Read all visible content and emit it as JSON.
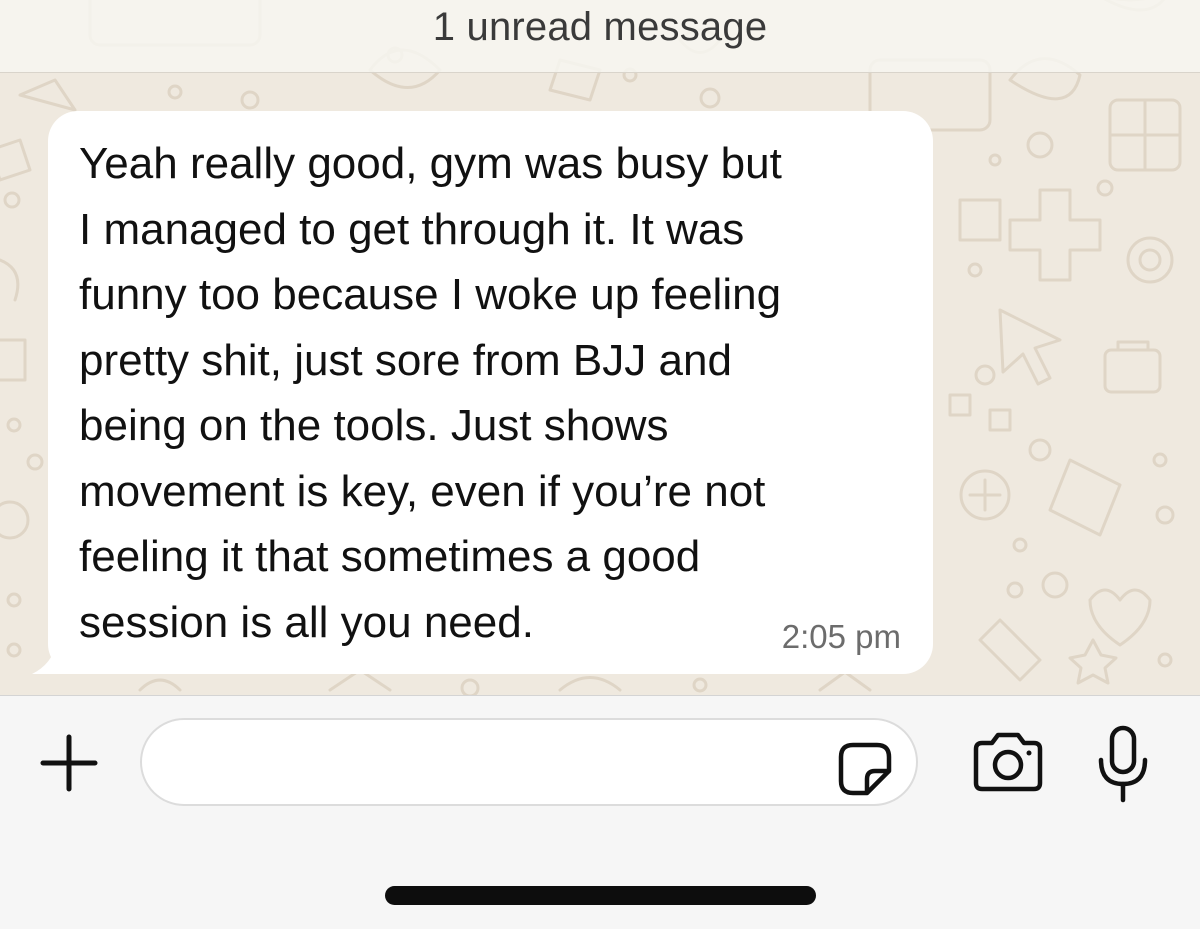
{
  "chat": {
    "unread_banner": "1 unread message",
    "message": {
      "text": "Yeah really good, gym was busy but\nI managed to get through it. It was\nfunny too because I woke up feeling\npretty shit, just sore from BJJ and\nbeing on the tools. Just shows\nmovement is key, even if you’re not\nfeeling it that sometimes a good\nsession is all you need.",
      "time": "2:05 pm",
      "direction": "incoming"
    }
  },
  "composer": {
    "input_value": "",
    "icons": {
      "add": "plus-icon",
      "sticker": "sticker-icon",
      "camera": "camera-icon",
      "microphone": "microphone-icon"
    }
  },
  "colors": {
    "wallpaper": "#efe9df",
    "bubble": "#ffffff",
    "composer": "#f6f6f6",
    "text": "#111111",
    "timestamp": "#6c6c6c"
  }
}
